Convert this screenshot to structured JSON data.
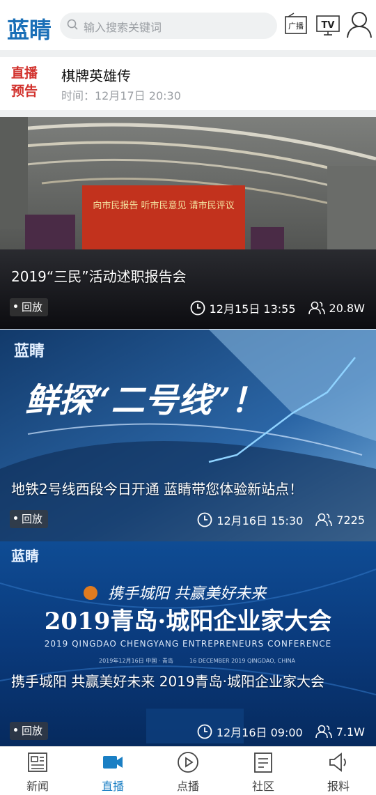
{
  "header": {
    "logo_text": "蓝睛",
    "search_placeholder": "输入搜索关键词",
    "radio_label": "广播",
    "tv_label": "TV"
  },
  "preview": {
    "tag": "直播预告",
    "title": "棋牌英雄传",
    "time": "时间：12月17日 20:30"
  },
  "cards": [
    {
      "title": "2019“三民”活动述职报告会",
      "badge": "回放",
      "time": "12月15日 13:55",
      "views": "20.8W",
      "banner_text": "向市民报告  听市民意见  请市民评议"
    },
    {
      "title": "地铁2号线西段今日开通 蓝睛带您体验新站点！",
      "badge": "回放",
      "time": "12月16日 15:30",
      "views": "7225",
      "overlay_text": "鲜探“二号线”！",
      "logo": "蓝睛"
    },
    {
      "title": "携手城阳 共赢美好未来 2019青岛·城阳企业家大会",
      "badge": "回放",
      "time": "12月16日 09:00",
      "views": "7.1W",
      "slogan": "携手城阳  共赢美好未来",
      "headline": "2019青岛·城阳企业家大会",
      "subline": "2019 QINGDAO CHENGYANG ENTREPRENEURS CONFERENCE",
      "small_left": "2019年12月16日    中国 · 青岛",
      "small_right": "16 DECEMBER 2019    QINGDAO, CHINA",
      "logo": "蓝睛"
    }
  ],
  "tabbar": [
    {
      "label": "新闻",
      "icon": "news-icon"
    },
    {
      "label": "直播",
      "icon": "live-camera-icon",
      "active": true
    },
    {
      "label": "点播",
      "icon": "play-icon"
    },
    {
      "label": "社区",
      "icon": "community-icon"
    },
    {
      "label": "报料",
      "icon": "report-icon"
    }
  ],
  "colors": {
    "accent": "#1a7fc4",
    "live_tag": "#d2322d"
  }
}
